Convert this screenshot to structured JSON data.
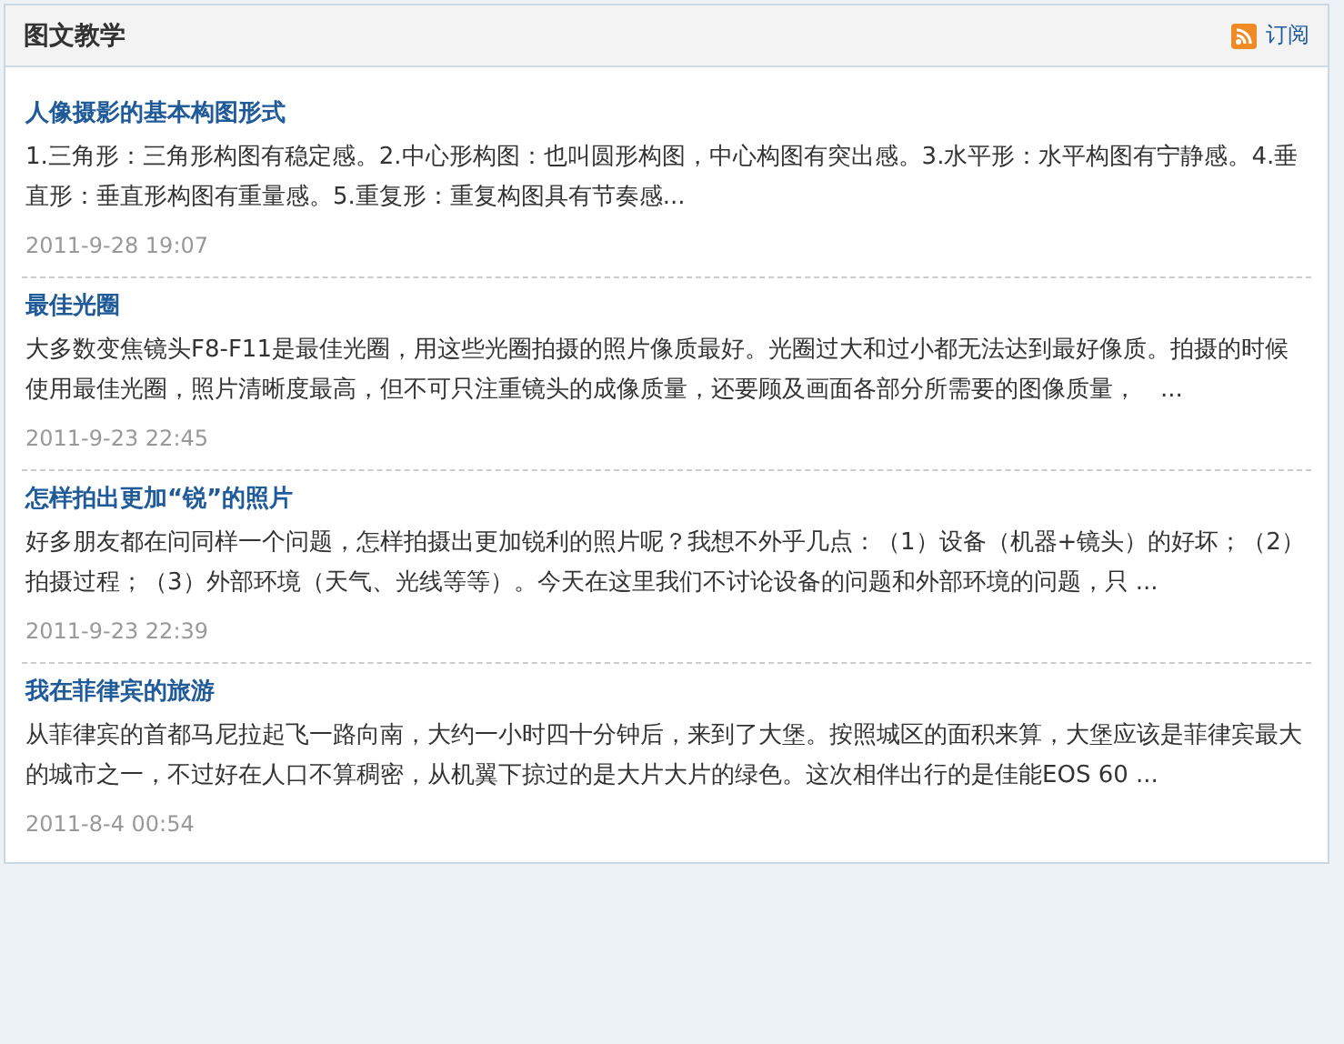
{
  "panel": {
    "title": "图文教学",
    "subscribe": "订阅"
  },
  "posts": [
    {
      "title": "人像摄影的基本构图形式",
      "summary": "1.三角形：三角形构图有稳定感。2.中心形构图：也叫圆形构图，中心构图有突出感。3.水平形：水平构图有宁静感。4.垂直形：垂直形构图有重量感。5.重复形：重复构图具有节奏感...",
      "date": "2011-9-28 19:07"
    },
    {
      "title": "最佳光圈",
      "summary": "大多数变焦镜头F8-F11是最佳光圈，用这些光圈拍摄的照片像质最好。光圈过大和过小都无法达到最好像质。拍摄的时候使用最佳光圈，照片清晰度最高，但不可只注重镜头的成像质量，还要顾及画面各部分所需要的图像质量，　...",
      "date": "2011-9-23 22:45"
    },
    {
      "title": "怎样拍出更加“锐”的照片",
      "summary": "好多朋友都在问同样一个问题，怎样拍摄出更加锐利的照片呢？我想不外乎几点：（1）设备（机器+镜头）的好坏；（2）拍摄过程；（3）外部环境（天气、光线等等）。今天在这里我们不讨论设备的问题和外部环境的问题，只 ...",
      "date": "2011-9-23 22:39"
    },
    {
      "title": "我在菲律宾的旅游",
      "summary": "从菲律宾的首都马尼拉起飞一路向南，大约一小时四十分钟后，来到了大堡。按照城区的面积来算，大堡应该是菲律宾最大的城市之一，不过好在人口不算稠密，从机翼下掠过的是大片大片的绿色。这次相伴出行的是佳能EOS 60 ...",
      "date": "2011-8-4 00:54"
    }
  ]
}
